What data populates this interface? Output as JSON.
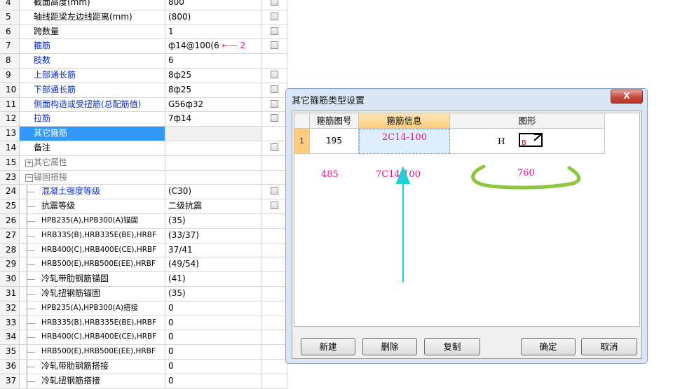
{
  "grid_rows": [
    {
      "num": "4",
      "name": "截面高度(mm)",
      "value": "800",
      "chk": true,
      "style": "normal"
    },
    {
      "num": "5",
      "name": "轴线距梁左边线距离(mm)",
      "value": "(800)",
      "chk": true,
      "style": "normal"
    },
    {
      "num": "6",
      "name": "跨数量",
      "value": "1",
      "chk": true,
      "style": "normal"
    },
    {
      "num": "7",
      "name": "箍筋",
      "value": "ф14@100(6",
      "chk": true,
      "style": "blue",
      "annot": "2"
    },
    {
      "num": "8",
      "name": "肢数",
      "value": "6",
      "chk": false,
      "style": "blue"
    },
    {
      "num": "9",
      "name": "上部通长筋",
      "value": "8ф25",
      "chk": true,
      "style": "blue"
    },
    {
      "num": "10",
      "name": "下部通长筋",
      "value": "8ф25",
      "chk": true,
      "style": "blue"
    },
    {
      "num": "11",
      "name": "侧面构造或受扭筋(总配筋值)",
      "value": "G56ф32",
      "chk": true,
      "style": "blue"
    },
    {
      "num": "12",
      "name": "拉筋",
      "value": "7ф14",
      "chk": true,
      "style": "blue"
    },
    {
      "num": "13",
      "name": "其它箍筋",
      "value": "",
      "chk": false,
      "style": "selected"
    },
    {
      "num": "14",
      "name": "备注",
      "value": "",
      "chk": true,
      "style": "normal"
    },
    {
      "num": "15",
      "name": "其它属性",
      "value": "",
      "chk": false,
      "style": "group",
      "expander": "+"
    },
    {
      "num": "23",
      "name": "锚固搭接",
      "value": "",
      "chk": false,
      "style": "group",
      "expander": "−"
    },
    {
      "num": "24",
      "name": "混凝土强度等级",
      "value": "(C30)",
      "chk": true,
      "style": "tree-blue"
    },
    {
      "num": "25",
      "name": "抗震等级",
      "value": "二级抗震",
      "chk": true,
      "style": "tree"
    },
    {
      "num": "26",
      "name": "HPB235(A),HPB300(A)锚固",
      "value": "(35)",
      "chk": false,
      "style": "tree-small"
    },
    {
      "num": "27",
      "name": "HRB335(B),HRB335E(BE),HRBF",
      "value": "(33/37)",
      "chk": false,
      "style": "tree-small"
    },
    {
      "num": "28",
      "name": "HRB400(C),HRB400E(CE),HRBF",
      "value": "37/41",
      "chk": false,
      "style": "tree-small"
    },
    {
      "num": "29",
      "name": "HRB500(E),HRB500E(EE),HRBF",
      "value": "(49/54)",
      "chk": false,
      "style": "tree-small"
    },
    {
      "num": "30",
      "name": "冷轧带肋钢筋锚固",
      "value": "(41)",
      "chk": false,
      "style": "tree"
    },
    {
      "num": "31",
      "name": "冷轧扭钢筋锚固",
      "value": "(35)",
      "chk": false,
      "style": "tree"
    },
    {
      "num": "32",
      "name": "HPB235(A),HPB300(A)搭接",
      "value": "0",
      "chk": false,
      "style": "tree-small"
    },
    {
      "num": "33",
      "name": "HRB335(B),HRB335E(BE),HRBF",
      "value": "0",
      "chk": false,
      "style": "tree-small"
    },
    {
      "num": "34",
      "name": "HRB400(C),HRB400E(CE),HRBF",
      "value": "0",
      "chk": false,
      "style": "tree-small"
    },
    {
      "num": "35",
      "name": "HRB500(E),HRB500E(EE),HRBF",
      "value": "0",
      "chk": false,
      "style": "tree-small"
    },
    {
      "num": "36",
      "name": "冷轧带肋钢筋搭接",
      "value": "0",
      "chk": false,
      "style": "tree"
    },
    {
      "num": "37",
      "name": "冷轧扭钢筋搭接",
      "value": "0",
      "chk": false,
      "style": "tree"
    }
  ],
  "dialog": {
    "title": "其它箍筋类型设置",
    "close_label": "X",
    "headers": {
      "col1": "箍筋图号",
      "col2": "箍筋信息",
      "col3": "图形"
    },
    "row": {
      "num": "1",
      "shape_no": "195",
      "info": "2C14-100",
      "shape_h": "H",
      "shape_b": "B"
    },
    "annotations": {
      "a1": "485",
      "a2": "7C14-100",
      "a3": "760"
    },
    "buttons": {
      "new": "新建",
      "delete": "删除",
      "copy": "复制",
      "ok": "确定",
      "cancel": "取消"
    }
  },
  "colors": {
    "accent": "#3399ff",
    "annotation_pink": "#e0128c",
    "arrow_cyan": "#1fd0d6",
    "squiggle_green": "#8cc63f"
  }
}
